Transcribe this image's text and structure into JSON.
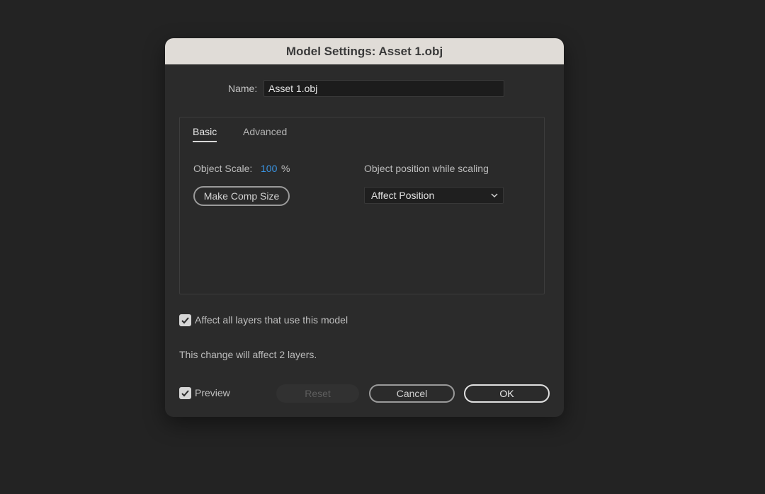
{
  "dialog": {
    "title": "Model Settings: Asset 1.obj",
    "name_label": "Name:",
    "name_value": "Asset 1.obj"
  },
  "tabs": {
    "basic_label": "Basic",
    "advanced_label": "Advanced",
    "active": "Basic"
  },
  "basic": {
    "scale_label": "Object Scale:",
    "scale_value": "100",
    "scale_unit": "%",
    "make_comp_label": "Make Comp Size",
    "position_label": "Object position while scaling",
    "position_selected": "Affect Position"
  },
  "options": {
    "affect_all_label": "Affect all layers that use this model",
    "affect_all_checked": true,
    "change_note": "This change will affect 2 layers.",
    "preview_label": "Preview",
    "preview_checked": true
  },
  "buttons": {
    "reset_label": "Reset",
    "cancel_label": "Cancel",
    "ok_label": "OK"
  },
  "colors": {
    "accent_value": "#3a95e4",
    "titlebar": "#e0dcd7",
    "dialog_bg": "#2b2b2b"
  },
  "icons": {
    "dropdown": "chevron-down-icon",
    "check": "checkmark-icon"
  }
}
